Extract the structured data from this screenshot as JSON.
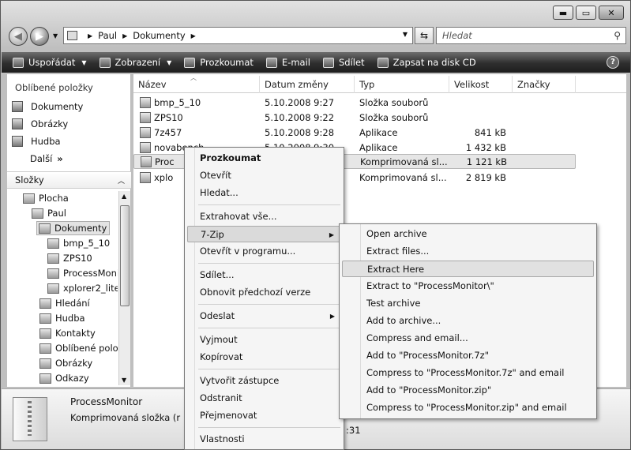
{
  "address": {
    "crumbs": [
      "Paul",
      "Dokumenty"
    ]
  },
  "search": {
    "placeholder": "Hledat"
  },
  "toolbar": {
    "organize": "Uspořádat",
    "views": "Zobrazení",
    "explore": "Prozkoumat",
    "email": "E-mail",
    "share": "Sdílet",
    "burn": "Zapsat na disk CD"
  },
  "nav": {
    "favorites_heading": "Oblíbené položky",
    "favorites": [
      "Dokumenty",
      "Obrázky",
      "Hudba"
    ],
    "more": "Další",
    "folders_heading": "Složky",
    "tree": [
      "Plocha",
      "Paul",
      "Dokumenty",
      "bmp_5_10",
      "ZPS10",
      "ProcessMoni",
      "xplorer2_lite",
      "Hledání",
      "Hudba",
      "Kontakty",
      "Oblíbené polo",
      "Obrázky",
      "Odkazy"
    ]
  },
  "columns": [
    "Název",
    "Datum změny",
    "Typ",
    "Velikost",
    "Značky"
  ],
  "files": [
    {
      "name": "bmp_5_10",
      "date": "5.10.2008 9:27",
      "type": "Složka souborů",
      "size": ""
    },
    {
      "name": "ZPS10",
      "date": "5.10.2008 9:22",
      "type": "Složka souborů",
      "size": ""
    },
    {
      "name": "7z457",
      "date": "5.10.2008 9:28",
      "type": "Aplikace",
      "size": "841 kB"
    },
    {
      "name": "novabench",
      "date": "5.10.2008 9:30",
      "type": "Aplikace",
      "size": "1 432 kB"
    },
    {
      "name": "Proc",
      "date": "",
      "type": "Komprimovaná sl...",
      "size": "1 121 kB"
    },
    {
      "name": "xplo",
      "date": "",
      "type": "Komprimovaná sl...",
      "size": "2 819 kB"
    }
  ],
  "details": {
    "name": "ProcessMonitor",
    "type": "Komprimovaná složka (r",
    "extra": ":31"
  },
  "context_menu": {
    "explore": "Prozkoumat",
    "open": "Otevřít",
    "search": "Hledat...",
    "extract_all": "Extrahovat vše...",
    "sevenzip": "7-Zip",
    "open_with": "Otevřít v programu...",
    "share": "Sdílet...",
    "restore": "Obnovit předchozí verze",
    "send_to": "Odeslat",
    "cut": "Vyjmout",
    "copy": "Kopírovat",
    "shortcut": "Vytvořit zástupce",
    "delete": "Odstranit",
    "rename": "Přejmenovat",
    "properties": "Vlastnosti"
  },
  "submenu": [
    "Open archive",
    "Extract files...",
    "Extract Here",
    "Extract to \"ProcessMonitor\\\"",
    "Test archive",
    "Add to archive...",
    "Compress and email...",
    "Add to \"ProcessMonitor.7z\"",
    "Compress to \"ProcessMonitor.7z\" and email",
    "Add to \"ProcessMonitor.zip\"",
    "Compress to \"ProcessMonitor.zip\" and email"
  ]
}
